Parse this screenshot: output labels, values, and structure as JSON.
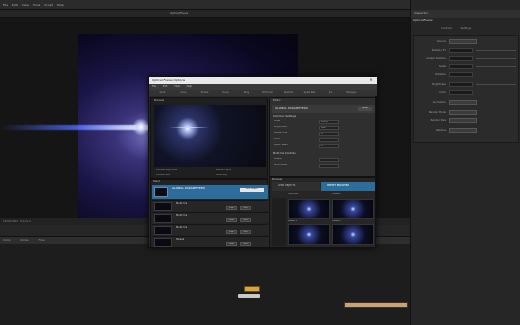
{
  "app": {
    "menu": [
      "File",
      "Edit",
      "View",
      "Tools",
      "Script",
      "Help"
    ]
  },
  "viewer": {
    "tab": "OpticalFlares",
    "status": "1920x1080 · Frame 0"
  },
  "node_graph": {
    "tabs": [
      "Comp",
      "Nodes",
      "Flow"
    ]
  },
  "inspector": {
    "header": "Inspector",
    "tool_title": "OpticalFlares",
    "tabs": [
      "Controls",
      "Settings"
    ],
    "params": [
      {
        "label": "Source",
        "value": ""
      },
      {
        "label": "Position XY",
        "value": ""
      },
      {
        "label": "Center Position",
        "value": ""
      },
      {
        "label": "Scale",
        "value": ""
      },
      {
        "label": "Rotation",
        "value": ""
      },
      {
        "label": "Brightness",
        "value": ""
      },
      {
        "label": "Color",
        "value": ""
      },
      {
        "label": "Animation",
        "value": ""
      },
      {
        "label": "Render Mode",
        "value": ""
      },
      {
        "label": "Render Size",
        "value": ""
      },
      {
        "label": "Options",
        "value": ""
      }
    ]
  },
  "dialog": {
    "title": "Optical Flares Options",
    "close_icon": "close-icon",
    "menu": [
      "File",
      "Edit",
      "View",
      "Help"
    ],
    "tabs": [
      "Glint",
      "Glow",
      "Streak",
      "Hoop",
      "Ring",
      "Shimmer",
      "Sparkle",
      "Spike Ball",
      "Iris",
      "Hexagon"
    ],
    "preview": {
      "label": "Preview",
      "info": [
        "Preview Brightness",
        "Preview Size",
        "Render Lights",
        "Show Bkg"
      ]
    },
    "editor": {
      "label": "Editor",
      "title": "GLOBAL PARAMETERS",
      "reset": "Reset",
      "section_common": "Common Settings",
      "rows": [
        {
          "label": "Scale",
          "value": "100.0"
        },
        {
          "label": "Brightness",
          "value": "100"
        },
        {
          "label": "Global Hue",
          "value": "0"
        },
        {
          "label": "Color",
          "value": ""
        },
        {
          "label": "Static Seed",
          "value": "0"
        }
      ],
      "section_multi": "Multi Iris Controls",
      "multi_rows": [
        {
          "label": "Shape",
          "value": ""
        },
        {
          "label": "Roundness",
          "value": ""
        }
      ]
    },
    "stack": {
      "label": "Stack",
      "title": "GLOBAL PARAMETERS",
      "add_button": "Add Object",
      "items": [
        {
          "name": "Multi Iris",
          "buttons": [
            "Hide",
            "Solo"
          ]
        },
        {
          "name": "Multi Iris",
          "buttons": [
            "Hide",
            "Solo"
          ]
        },
        {
          "name": "Multi Iris",
          "buttons": [
            "Hide",
            "Solo"
          ]
        },
        {
          "name": "Streak",
          "buttons": [
            "Hide",
            "Solo"
          ]
        }
      ]
    },
    "browser": {
      "label": "Browser",
      "tab_lens": "LENS OBJECTS",
      "tab_preset": "PRESET BROWSER",
      "subfolders": [
        "Favorites",
        "Presets"
      ],
      "thumbs": [
        "Preset 1",
        "Preset 2",
        "Preset 3",
        "Preset 4"
      ]
    }
  },
  "colors": {
    "accent": "#2c6d9c",
    "node": "#d8a441"
  }
}
